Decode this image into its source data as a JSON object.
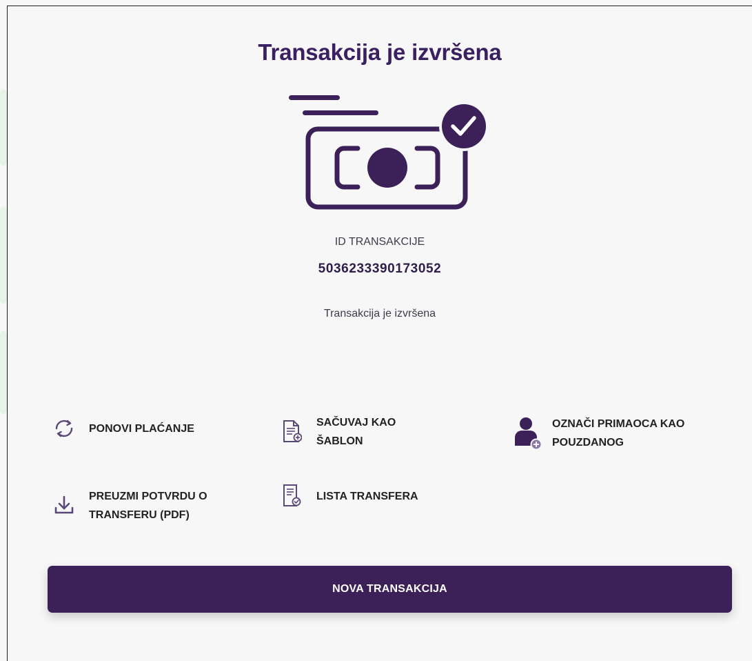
{
  "title": "Transakcija je izvršena",
  "illustration": "money-check-icon",
  "transaction": {
    "id_label": "ID TRANSAKCIJE",
    "id_value": "5036233390173052",
    "status": "Transakcija je izvršena"
  },
  "actions": [
    {
      "label": "PONOVI PLAĆANJE",
      "icon": "repeat-icon"
    },
    {
      "label": "SAČUVAJ KAO ŠABLON",
      "icon": "document-add-icon"
    },
    {
      "label": "OZNAČI PRIMAOCA KAO POUZDANOG",
      "icon": "user-add-icon"
    },
    {
      "label": "PREUZMI POTVRDU O TRANSFERU (PDF)",
      "icon": "download-icon"
    },
    {
      "label": "LISTA TRANSFERA",
      "icon": "document-list-icon"
    }
  ],
  "new_transaction_label": "NOVA TRANSAKCIJA",
  "colors": {
    "primary": "#3b2158",
    "text": "#222222",
    "background": "#f7f7f7",
    "accent_bg": "#e6f3e6"
  }
}
